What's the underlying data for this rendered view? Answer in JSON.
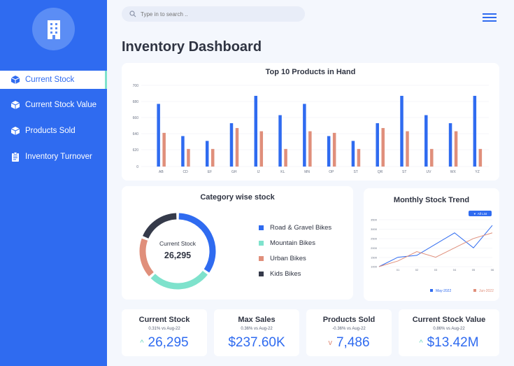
{
  "search": {
    "placeholder": "Type in to search .."
  },
  "sidebar": {
    "items": [
      {
        "label": "Current Stock"
      },
      {
        "label": "Current Stock Value"
      },
      {
        "label": "Products Sold"
      },
      {
        "label": "Inventory Turnover"
      }
    ]
  },
  "page": {
    "title": "Inventory Dashboard"
  },
  "colors": {
    "primary": "#2f6bf0",
    "salmon": "#e08f7b",
    "mint": "#7ee2cc",
    "dark": "#353a4a"
  },
  "charts": {
    "top10": {
      "title": "Top 10 Products in Hand",
      "chart_data": {
        "type": "bar",
        "categories": [
          "AB",
          "CD",
          "EF",
          "GH",
          "IJ",
          "KL",
          "MN",
          "OP",
          "ST",
          "QR",
          "ST",
          "UV",
          "WX",
          "YZ"
        ],
        "series": [
          {
            "values": [
              677,
              637,
              631,
              653,
              687,
              663,
              677,
              637,
              631,
              653,
              687,
              663,
              653,
              687
            ]
          },
          {
            "values": [
              641,
              621,
              621,
              647,
              643,
              621,
              643,
              641,
              621,
              647,
              643,
              621,
              643,
              621
            ]
          }
        ],
        "yticks": [
          "700",
          "680",
          "660",
          "640",
          "620",
          "0"
        ],
        "y_break": "axis jumps from 620 to 0 (broken axis)",
        "grid": "horizontal"
      }
    },
    "category": {
      "title": "Category wise stock",
      "center_label": "Current Stock",
      "center_value": "26,295",
      "chart_data": {
        "type": "pie",
        "style": "donut",
        "categories": [
          "Road & Gravel Bikes",
          "Mountain Bikes",
          "Urban Bikes",
          "Kids Bikes"
        ],
        "values": [
          35,
          28,
          18,
          19
        ],
        "colors": [
          "#2f6bf0",
          "#7ee2cc",
          "#e08f7b",
          "#353a4a"
        ]
      }
    },
    "trend": {
      "title": "Monthly Stock Trend",
      "dropdown": "All List",
      "chart_data": {
        "type": "line",
        "x": [
          "01",
          "02",
          "03",
          "04",
          "05",
          "06"
        ],
        "yticks": [
          "3500",
          "3000",
          "2500",
          "2000",
          "1500",
          "1000"
        ],
        "series": [
          {
            "name": "May-2022",
            "color": "#2f6bf0",
            "values": [
              500,
              1500,
              1600,
              2200,
              2800,
              2000,
              3200
            ]
          },
          {
            "name": "Jun-2022",
            "color": "#e08f7b",
            "values": [
              500,
              1300,
              1800,
              1500,
              2000,
              2500,
              2800
            ]
          }
        ],
        "grid": "horizontal",
        "legend": "bottom"
      }
    }
  },
  "kpis": [
    {
      "title": "Current Stock",
      "sub": "0.31% vs Aug-22",
      "value": "26,295",
      "arrow": "^",
      "trend": "up"
    },
    {
      "title": "Max Sales",
      "sub": "0.36% vs Aug-22",
      "value": "$237.60K",
      "arrow": "",
      "trend": "none"
    },
    {
      "title": "Products Sold",
      "sub": "-0.36% vs Aug-22",
      "value": "7,486",
      "arrow": "v",
      "trend": "down"
    },
    {
      "title": "Current Stock Value",
      "sub": "0.86% vs Aug-22",
      "value": "$13.42M",
      "arrow": "^",
      "trend": "up"
    }
  ]
}
